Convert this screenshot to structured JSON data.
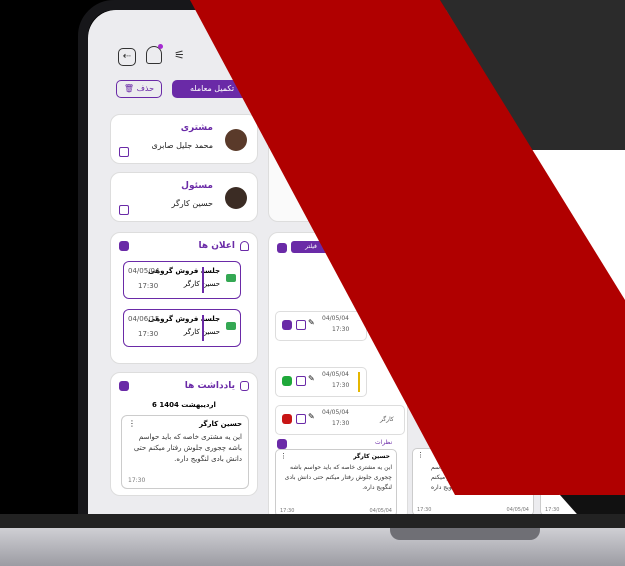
{
  "header": {
    "complete_deal": "تکمیل معامله",
    "delete": "حذف"
  },
  "customer": {
    "title": "مشتری",
    "name": "محمد جلیل صابری"
  },
  "responsible": {
    "title": "مسئول",
    "name": "حسین کارگر"
  },
  "announcements": {
    "title": "اعلان ها",
    "events": [
      {
        "title": "جلسه فروش گروهی",
        "person": "حسین کارگر",
        "date": "04/05/04",
        "time": "17:30"
      },
      {
        "title": "جلسه فروش گروهی",
        "person": "حسین کارگر",
        "date": "04/06/15",
        "time": "17:30"
      }
    ]
  },
  "notes": {
    "title": "یادداشت ها",
    "date_label": "6 اردیبهشت 1404",
    "author": "حسین کارگر",
    "text": "این یه مشتری خاصه که باید حواسم باشه چجوری جلوش رفتار میکنم حتی دانش بادی لنگویج داره.",
    "time": "17:30"
  },
  "middle": {
    "filter": "فیلتر",
    "rows": [
      {
        "date": "04/05/04",
        "time": "17:30"
      },
      {
        "date": "04/05/04",
        "time": "17:30"
      },
      {
        "date": "04/05/04",
        "time": "17:30"
      }
    ],
    "row3_name": "کارگر",
    "opinions_label": "نظرات",
    "comment": {
      "author": "حسین کارگر",
      "text": "این یه مشتری خاصه که باید حواسم باشه چجوری جلوش رفتار میکنم حتی دانش بادی لنگویج داره.",
      "time": "17:30",
      "date": "04/05/04"
    },
    "comment2_partial": [
      "د حواسم",
      "ار میکنم",
      "ویج داره."
    ],
    "comment2_time": "17:30",
    "comment2_date": "04/05/04",
    "comment3_time": "17:30"
  },
  "colors": {
    "accent": "#6a2aa7",
    "stripe": "#b00000"
  }
}
